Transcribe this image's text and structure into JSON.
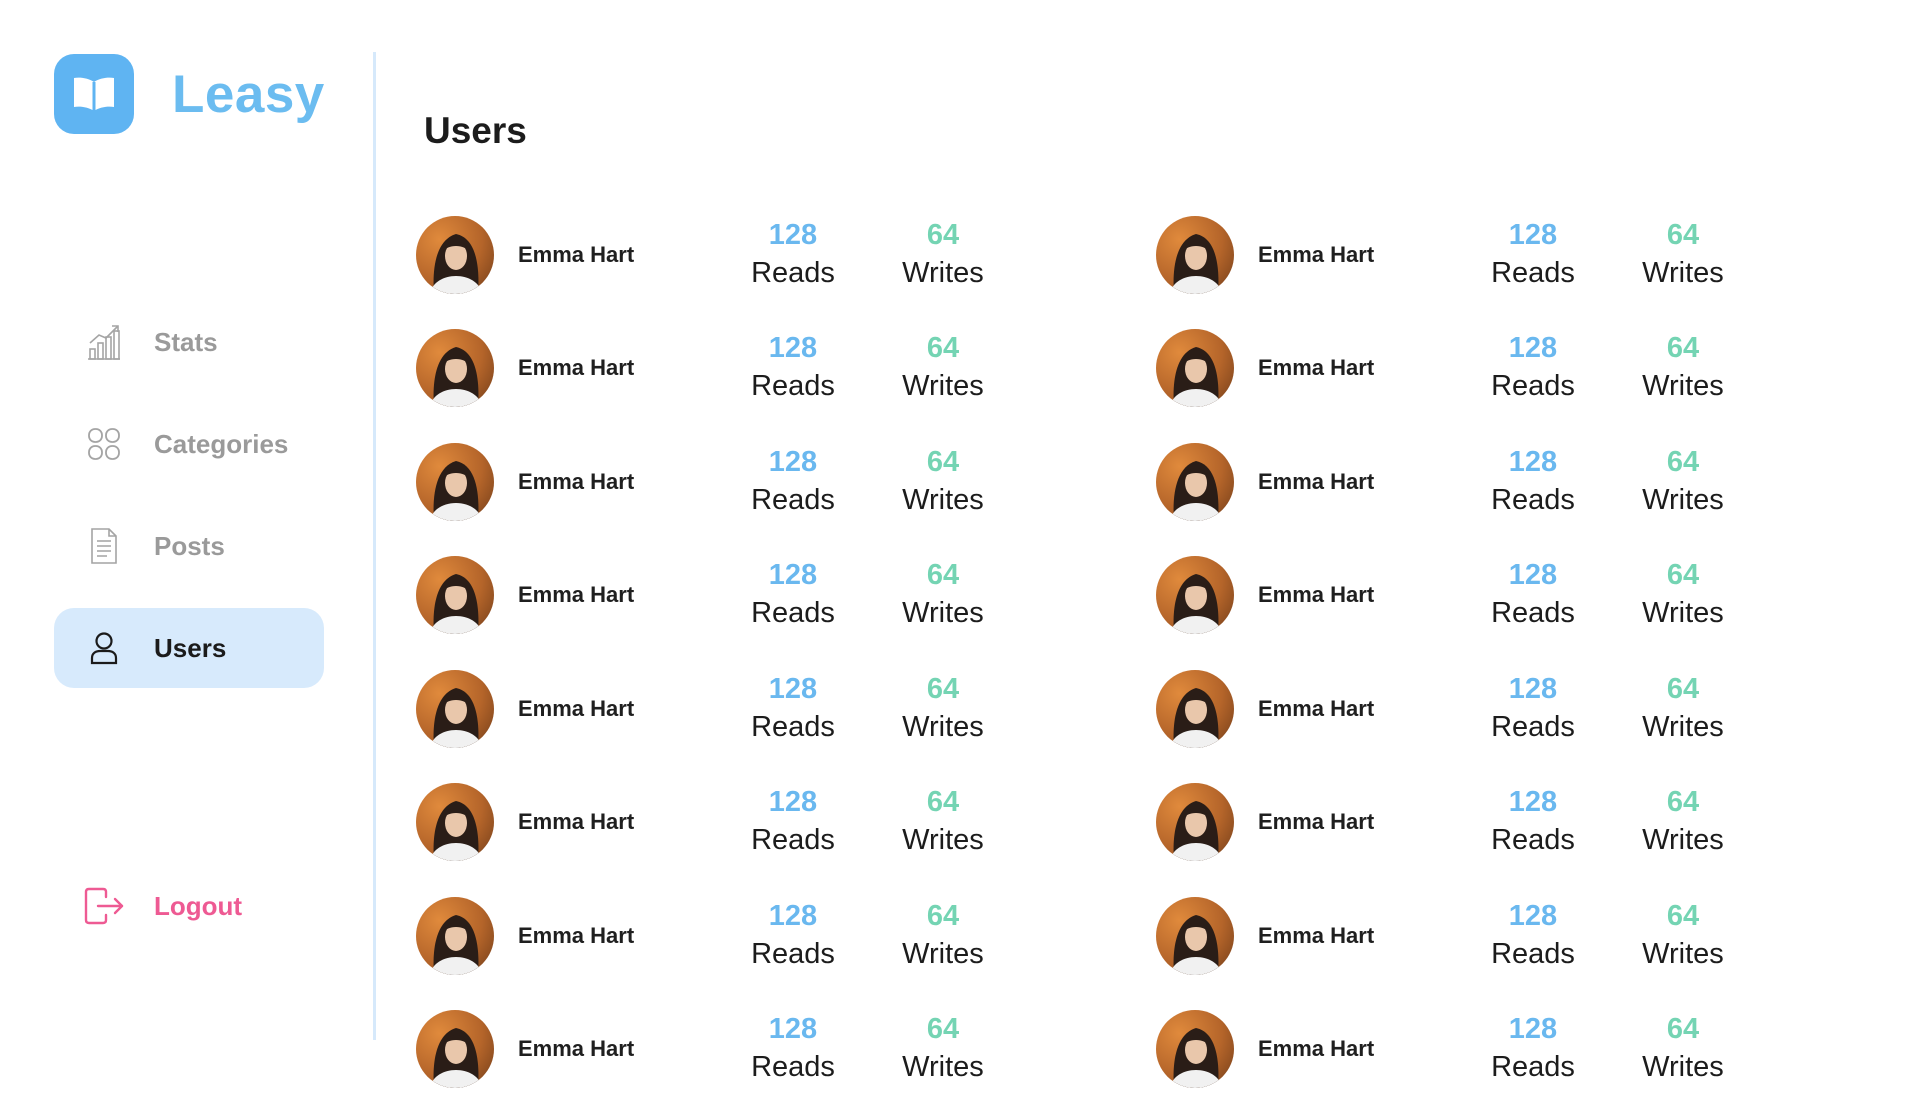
{
  "app": {
    "name": "Leasy",
    "brand_color": "#6bbcf0",
    "logo_icon": "open-book-icon"
  },
  "sidebar": {
    "items": [
      {
        "label": "Stats",
        "icon": "chart-icon",
        "active": false
      },
      {
        "label": "Categories",
        "icon": "grid-icon",
        "active": false
      },
      {
        "label": "Posts",
        "icon": "document-icon",
        "active": false
      },
      {
        "label": "Users",
        "icon": "user-icon",
        "active": true
      }
    ],
    "logout": {
      "label": "Logout",
      "icon": "logout-icon",
      "color": "#ee5a93"
    },
    "active_bg": "#d7eafc"
  },
  "main": {
    "title": "Users",
    "users": [
      {
        "name": "Emma Hart",
        "reads": "128",
        "reads_label": "Reads",
        "writes": "64",
        "writes_label": "Writes"
      },
      {
        "name": "Emma Hart",
        "reads": "128",
        "reads_label": "Reads",
        "writes": "64",
        "writes_label": "Writes"
      },
      {
        "name": "Emma Hart",
        "reads": "128",
        "reads_label": "Reads",
        "writes": "64",
        "writes_label": "Writes"
      },
      {
        "name": "Emma Hart",
        "reads": "128",
        "reads_label": "Reads",
        "writes": "64",
        "writes_label": "Writes"
      },
      {
        "name": "Emma Hart",
        "reads": "128",
        "reads_label": "Reads",
        "writes": "64",
        "writes_label": "Writes"
      },
      {
        "name": "Emma Hart",
        "reads": "128",
        "reads_label": "Reads",
        "writes": "64",
        "writes_label": "Writes"
      },
      {
        "name": "Emma Hart",
        "reads": "128",
        "reads_label": "Reads",
        "writes": "64",
        "writes_label": "Writes"
      },
      {
        "name": "Emma Hart",
        "reads": "128",
        "reads_label": "Reads",
        "writes": "64",
        "writes_label": "Writes"
      },
      {
        "name": "Emma Hart",
        "reads": "128",
        "reads_label": "Reads",
        "writes": "64",
        "writes_label": "Writes"
      },
      {
        "name": "Emma Hart",
        "reads": "128",
        "reads_label": "Reads",
        "writes": "64",
        "writes_label": "Writes"
      },
      {
        "name": "Emma Hart",
        "reads": "128",
        "reads_label": "Reads",
        "writes": "64",
        "writes_label": "Writes"
      },
      {
        "name": "Emma Hart",
        "reads": "128",
        "reads_label": "Reads",
        "writes": "64",
        "writes_label": "Writes"
      },
      {
        "name": "Emma Hart",
        "reads": "128",
        "reads_label": "Reads",
        "writes": "64",
        "writes_label": "Writes"
      },
      {
        "name": "Emma Hart",
        "reads": "128",
        "reads_label": "Reads",
        "writes": "64",
        "writes_label": "Writes"
      },
      {
        "name": "Emma Hart",
        "reads": "128",
        "reads_label": "Reads",
        "writes": "64",
        "writes_label": "Writes"
      },
      {
        "name": "Emma Hart",
        "reads": "128",
        "reads_label": "Reads",
        "writes": "64",
        "writes_label": "Writes"
      }
    ],
    "reads_color": "#6ab8ef",
    "writes_color": "#74d4b3"
  }
}
